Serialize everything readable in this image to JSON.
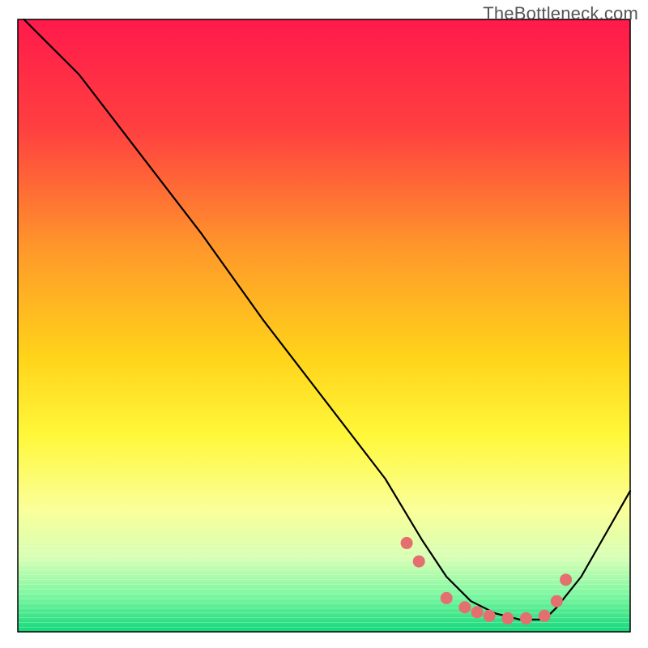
{
  "watermark": "TheBottleneck.com",
  "chart_data": {
    "type": "line",
    "title": "",
    "xlabel": "",
    "ylabel": "",
    "xlim": [
      0,
      100
    ],
    "ylim": [
      0,
      100
    ],
    "grid": false,
    "legend": false,
    "background": {
      "type": "vertical-gradient",
      "stops": [
        {
          "offset": 0.0,
          "color": "#ff1a4b"
        },
        {
          "offset": 0.18,
          "color": "#ff4040"
        },
        {
          "offset": 0.38,
          "color": "#ff9a2a"
        },
        {
          "offset": 0.55,
          "color": "#ffd31a"
        },
        {
          "offset": 0.68,
          "color": "#fff83a"
        },
        {
          "offset": 0.8,
          "color": "#faff9a"
        },
        {
          "offset": 0.88,
          "color": "#d6ffb4"
        },
        {
          "offset": 0.94,
          "color": "#7cf7a0"
        },
        {
          "offset": 1.0,
          "color": "#12d87a"
        }
      ]
    },
    "series": [
      {
        "name": "curve",
        "type": "line",
        "color": "#000000",
        "x": [
          1,
          4,
          8,
          10,
          20,
          30,
          40,
          50,
          60,
          63,
          66,
          70,
          74,
          78,
          82,
          86,
          88,
          92,
          96,
          100
        ],
        "y": [
          100,
          97,
          93,
          91,
          78,
          65,
          51,
          38,
          25,
          20,
          15,
          9,
          5,
          3,
          2,
          2,
          4,
          9,
          16,
          23
        ]
      },
      {
        "name": "markers",
        "type": "scatter",
        "color": "#e46f6f",
        "x": [
          63.5,
          65.5,
          70,
          73,
          75,
          77,
          80,
          83,
          86,
          88,
          89.5
        ],
        "y": [
          14.5,
          11.5,
          5.5,
          4,
          3.2,
          2.6,
          2.2,
          2.2,
          2.6,
          5,
          8.5
        ]
      }
    ]
  }
}
